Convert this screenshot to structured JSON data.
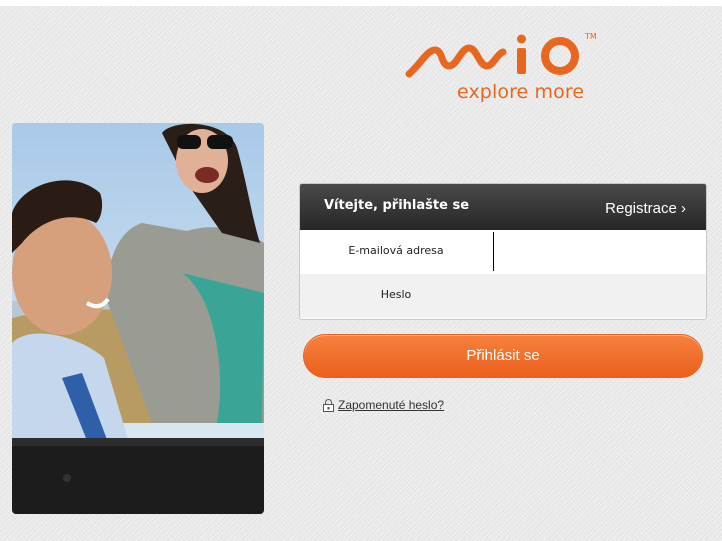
{
  "brand": {
    "name": "Mio",
    "trademark": "TM",
    "tagline": "explore more",
    "accent_color": "#e8671f"
  },
  "login": {
    "title": "Vítejte, přihlašte se",
    "register_label": "Registrace ›",
    "email_label": "E-mailová adresa",
    "email_value": "",
    "password_label": "Heslo",
    "password_value": "",
    "submit_label": "Přihlásit se",
    "forgot_label": "Zapomenuté heslo?"
  },
  "icons": {
    "forgot": "lock-icon"
  },
  "colors": {
    "button": "#f06b28",
    "header": "#333333",
    "background": "#e9e9e9"
  }
}
